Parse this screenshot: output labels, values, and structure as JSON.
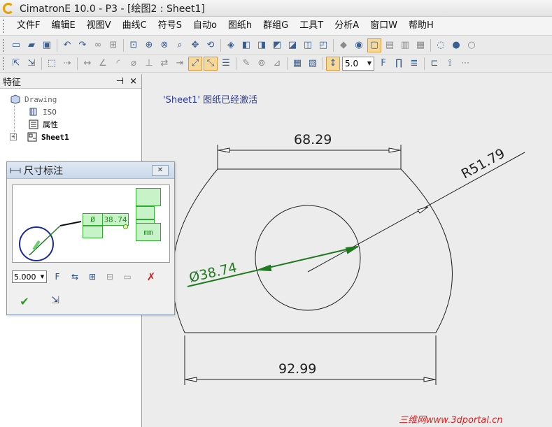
{
  "window": {
    "title": "CimatronE 10.0 - P3 - [绘图2 : Sheet1]"
  },
  "menu": [
    "文件F",
    "编辑E",
    "视图V",
    "曲线C",
    "符号S",
    "自动o",
    "图纸h",
    "群组G",
    "工具T",
    "分析A",
    "窗口W",
    "帮助H"
  ],
  "toolbar": {
    "scale_value": "5.0"
  },
  "feature_panel": {
    "title": "特征",
    "pin_label": "⊣",
    "close_label": "×",
    "tree": [
      {
        "label": "Drawing",
        "icon": "drawing-icon"
      },
      {
        "label": "ISO",
        "icon": "iso-icon"
      },
      {
        "label": "属性",
        "icon": "properties-icon"
      },
      {
        "label": "Sheet1",
        "icon": "sheet-icon"
      }
    ],
    "expand_label": "+"
  },
  "canvas": {
    "message": "'Sheet1' 图纸已经激活",
    "dims": {
      "top": "68.29",
      "bottom": "92.99",
      "radius": "R51.79",
      "diameter": "Ø38.74"
    }
  },
  "dialog": {
    "title": "尺寸标注",
    "close_label": "✕",
    "preview_prefix": "Ø",
    "preview_value": "38.74",
    "preview_unit": "mm",
    "text_size": "5.000"
  },
  "watermark": "三维网www.3dportal.cn",
  "colors": {
    "dim_green": "#1f7a1f",
    "message_blue": "#2a3a9a",
    "watermark_red": "#e02020"
  }
}
